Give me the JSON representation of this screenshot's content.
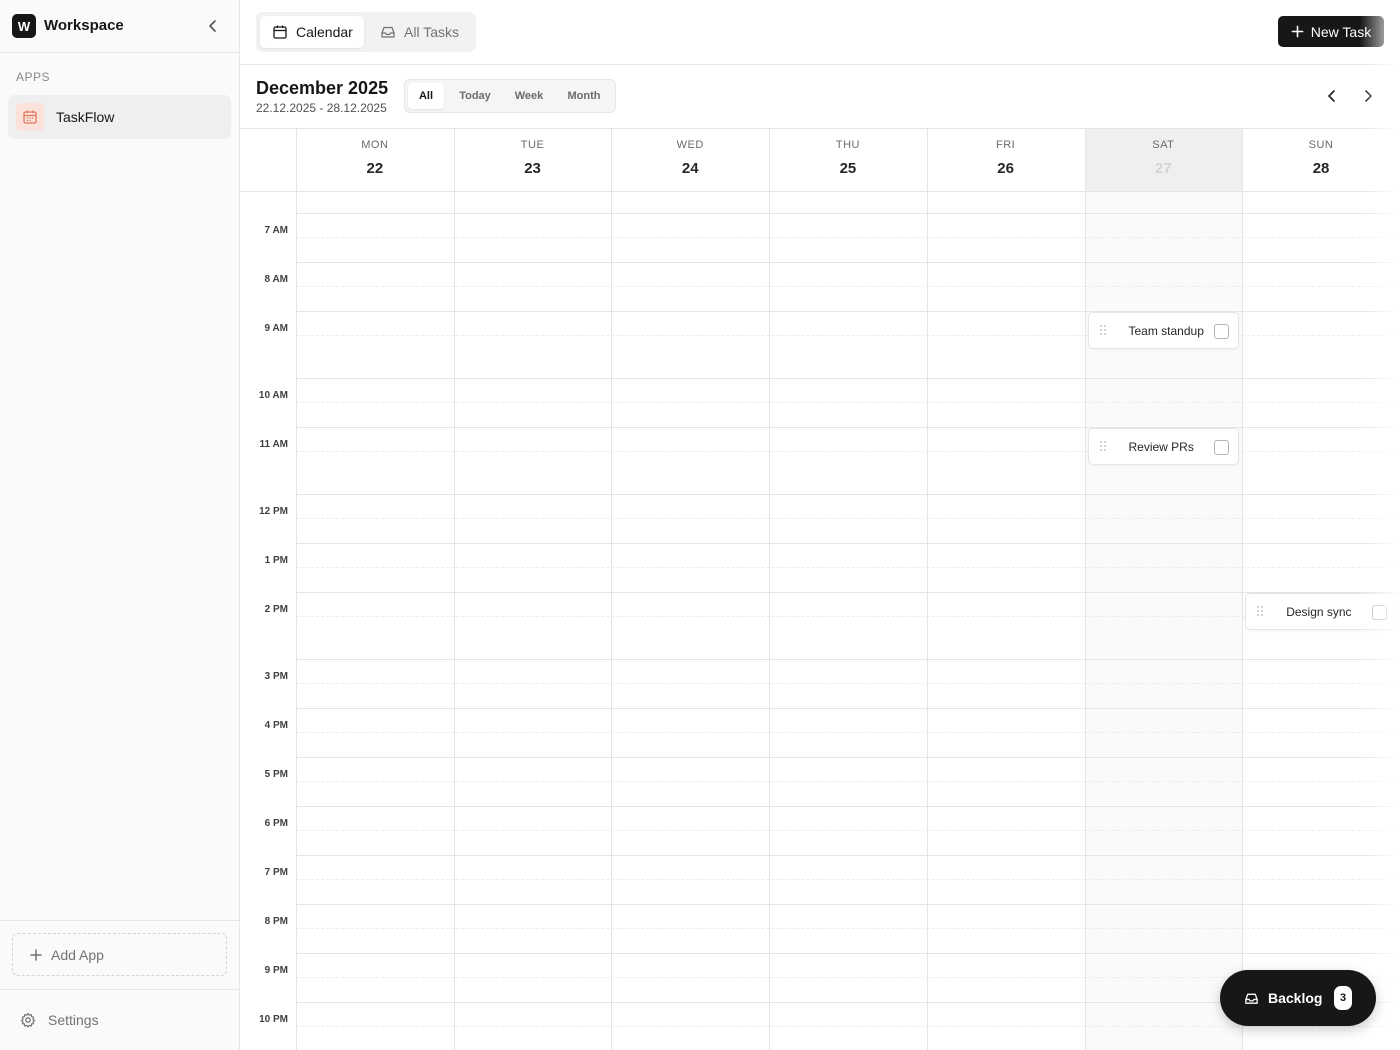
{
  "sidebar": {
    "workspace_initial": "W",
    "workspace_name": "Workspace",
    "apps_label": "APPS",
    "apps": [
      {
        "name": "TaskFlow",
        "icon": "calendar-icon",
        "icon_color": "#e07a5f"
      }
    ],
    "add_app_label": "Add App",
    "settings_label": "Settings"
  },
  "topbar": {
    "tabs": [
      {
        "label": "Calendar",
        "icon": "calendar-icon",
        "active": true
      },
      {
        "label": "All Tasks",
        "icon": "inbox-icon",
        "active": false
      }
    ],
    "new_task_label": "New Task"
  },
  "calendar": {
    "title": "December 2025",
    "range": "22.12.2025 - 28.12.2025",
    "range_tabs": [
      {
        "label": "All",
        "active": true
      },
      {
        "label": "Today",
        "active": false
      },
      {
        "label": "Week",
        "active": false
      },
      {
        "label": "Month",
        "active": false
      }
    ],
    "days": [
      {
        "name": "MON",
        "num": "22"
      },
      {
        "name": "TUE",
        "num": "23"
      },
      {
        "name": "WED",
        "num": "24"
      },
      {
        "name": "THU",
        "num": "25"
      },
      {
        "name": "FRI",
        "num": "26"
      },
      {
        "name": "SAT",
        "num": "27",
        "today": true
      },
      {
        "name": "SUN",
        "num": "28"
      }
    ],
    "hours": [
      "7 AM",
      "8 AM",
      "9 AM",
      "10 AM",
      "11 AM",
      "12 PM",
      "1 PM",
      "2 PM",
      "3 PM",
      "4 PM",
      "5 PM",
      "6 PM",
      "7 PM",
      "8 PM",
      "9 PM",
      "10 PM"
    ],
    "tasks": [
      {
        "title": "Team standup",
        "day": "SAT",
        "time": "9 AM",
        "done": false
      },
      {
        "title": "Review PRs",
        "day": "SAT",
        "time": "11 AM",
        "done": false
      },
      {
        "title": "Design sync",
        "day": "SUN",
        "time": "2 PM",
        "done": false
      }
    ]
  },
  "backlog": {
    "label": "Backlog",
    "count": "3"
  },
  "colors": {
    "accent": "#171717",
    "today_bg": "#efefef",
    "border": "#e5e5e5"
  }
}
